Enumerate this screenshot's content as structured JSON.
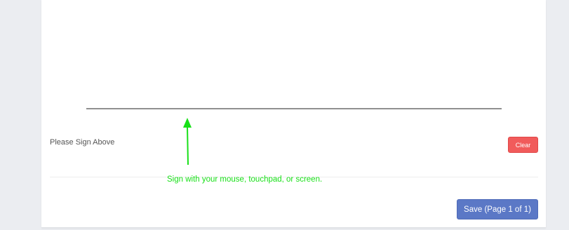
{
  "signature": {
    "label": "Please Sign Above",
    "clear_label": "Clear",
    "hint": "Sign with your mouse, touchpad, or screen.",
    "hint_color": "#18e018"
  },
  "footer": {
    "save_label": "Save (Page 1 of 1)"
  },
  "colors": {
    "clear_button": "#f15b5b",
    "save_button": "#5b78c6",
    "background": "#ebedf1",
    "signature_line": "#909090"
  }
}
